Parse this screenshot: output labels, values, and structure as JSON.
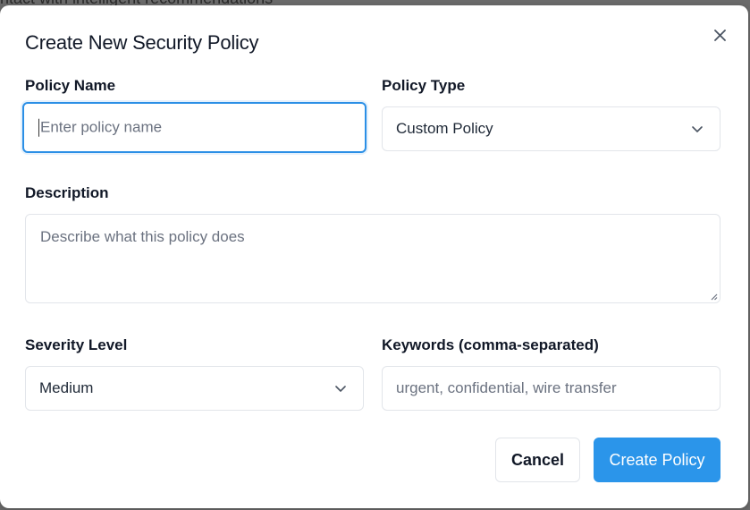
{
  "background": {
    "partial_text": "ntact with intelligent recommendations"
  },
  "dialog": {
    "title": "Create New Security Policy",
    "close_icon": "close-icon",
    "fields": {
      "policy_name": {
        "label": "Policy Name",
        "value": "",
        "placeholder": "Enter policy name"
      },
      "policy_type": {
        "label": "Policy Type",
        "selected": "Custom Policy"
      },
      "description": {
        "label": "Description",
        "value": "",
        "placeholder": "Describe what this policy does"
      },
      "severity": {
        "label": "Severity Level",
        "selected": "Medium"
      },
      "keywords": {
        "label": "Keywords (comma-separated)",
        "value": "",
        "placeholder": "urgent, confidential, wire transfer"
      }
    },
    "buttons": {
      "cancel": "Cancel",
      "create": "Create Policy"
    }
  },
  "colors": {
    "accent": "#2b95ea",
    "focus_border": "#2b8fe6",
    "border": "#e2e5ea",
    "text": "#111827",
    "placeholder": "#6b7280"
  }
}
